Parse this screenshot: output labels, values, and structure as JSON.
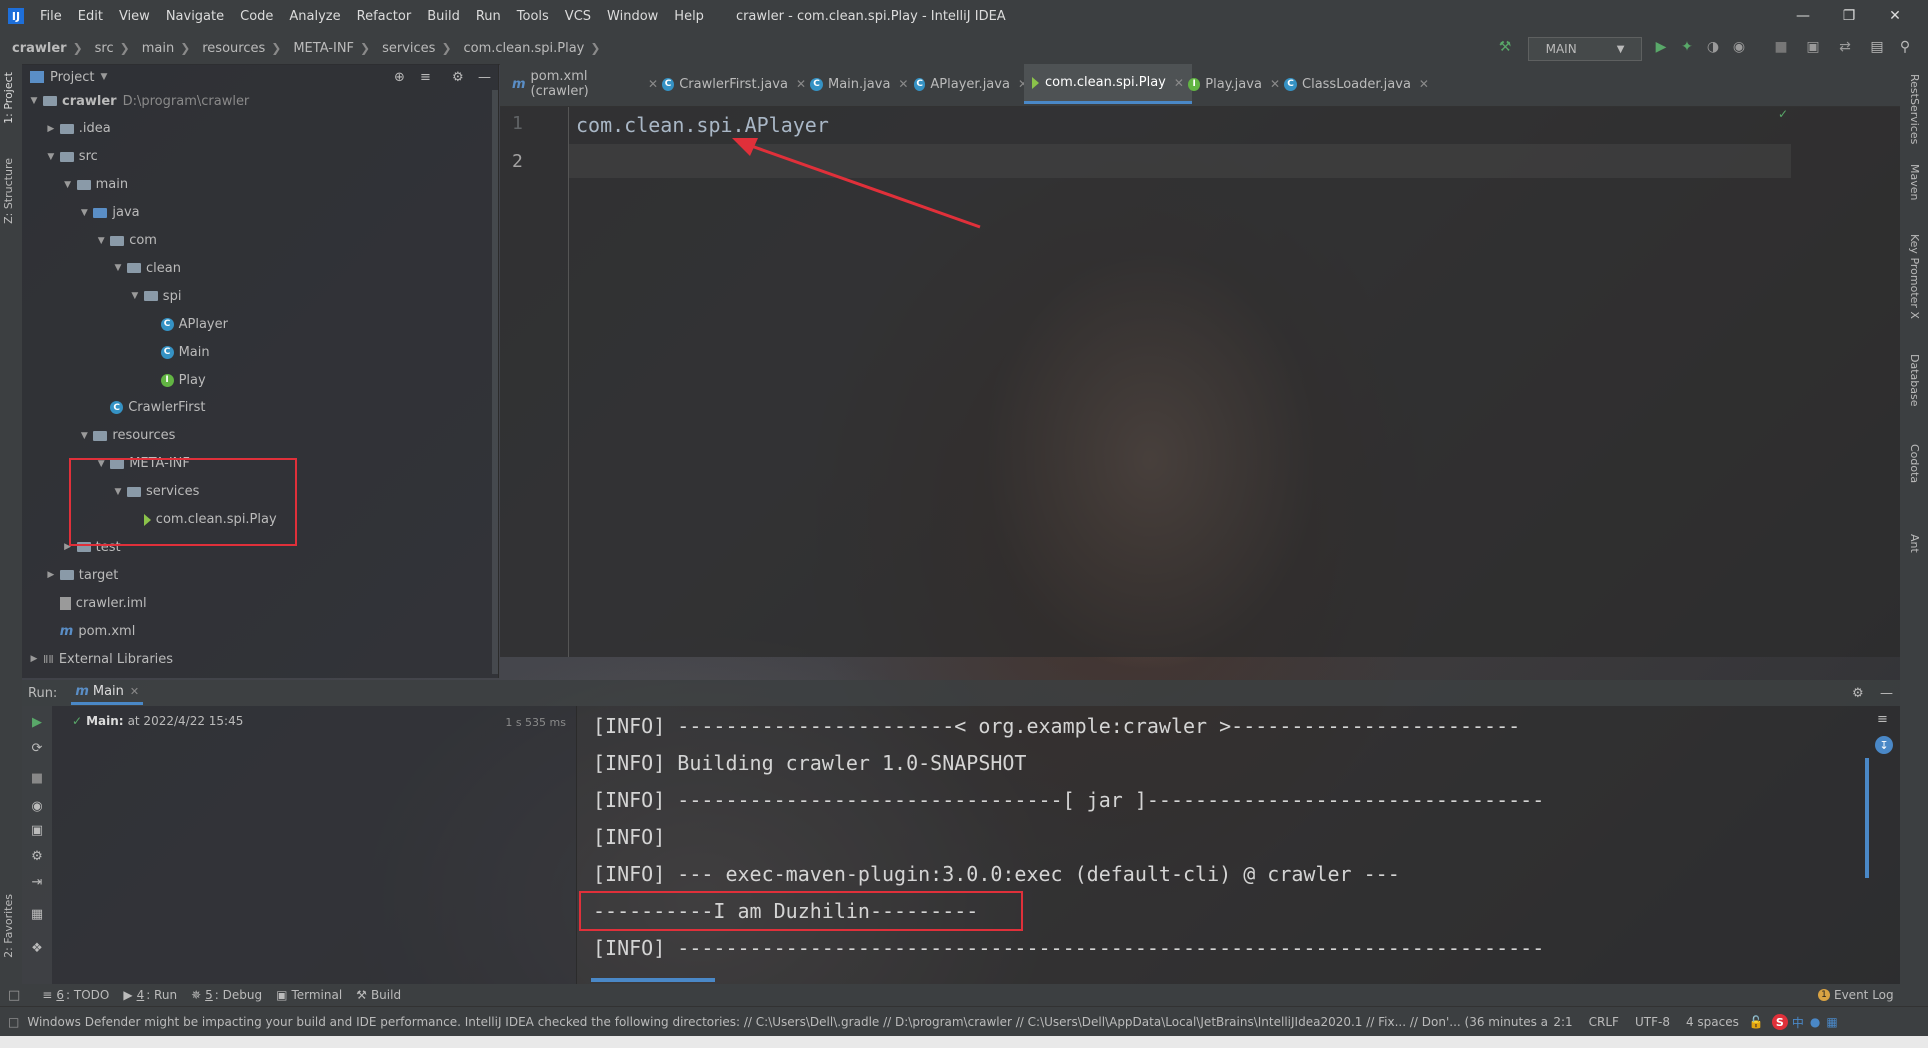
{
  "window": {
    "title": "crawler - com.clean.spi.Play - IntelliJ IDEA",
    "menu": [
      "File",
      "Edit",
      "View",
      "Navigate",
      "Code",
      "Analyze",
      "Refactor",
      "Build",
      "Run",
      "Tools",
      "VCS",
      "Window",
      "Help"
    ],
    "menu_mnemonics": [
      "F",
      "E",
      "V",
      "N",
      "C",
      "z",
      "R",
      "B",
      "u",
      "T",
      "S",
      "W",
      "H"
    ]
  },
  "breadcrumb": [
    "crawler",
    "src",
    "main",
    "resources",
    "META-INF",
    "services",
    "com.clean.spi.Play"
  ],
  "toolbar": {
    "run_config": "MAIN"
  },
  "left_strip": {
    "project_tab": "1: Project",
    "structure_tab": "Z: Structure",
    "favorites_tab": "2: Favorites"
  },
  "right_strip": [
    "RestServices",
    "Maven",
    "Key Promoter X",
    "Database",
    "Codota",
    "Ant"
  ],
  "project": {
    "header": "Project",
    "tree": [
      {
        "label": "crawler",
        "extra": "D:\\program\\crawler",
        "type": "root",
        "depth": 0,
        "open": true
      },
      {
        "label": ".idea",
        "type": "folder",
        "depth": 1,
        "open": false
      },
      {
        "label": "src",
        "type": "folder",
        "depth": 1,
        "open": true
      },
      {
        "label": "main",
        "type": "folder",
        "depth": 2,
        "open": true
      },
      {
        "label": "java",
        "type": "folder-blue",
        "depth": 3,
        "open": true
      },
      {
        "label": "com",
        "type": "folder",
        "depth": 4,
        "open": true
      },
      {
        "label": "clean",
        "type": "folder",
        "depth": 5,
        "open": true
      },
      {
        "label": "spi",
        "type": "folder",
        "depth": 6,
        "open": true
      },
      {
        "label": "APlayer",
        "type": "class",
        "depth": 7
      },
      {
        "label": "Main",
        "type": "class",
        "depth": 7
      },
      {
        "label": "Play",
        "type": "interface",
        "depth": 7
      },
      {
        "label": "CrawlerFirst",
        "type": "class",
        "depth": 4
      },
      {
        "label": "resources",
        "type": "folder-res",
        "depth": 3,
        "open": true
      },
      {
        "label": "META-INF",
        "type": "folder",
        "depth": 4,
        "open": true
      },
      {
        "label": "services",
        "type": "folder",
        "depth": 5,
        "open": true
      },
      {
        "label": "com.clean.spi.Play",
        "type": "file",
        "depth": 6
      },
      {
        "label": "test",
        "type": "folder",
        "depth": 2,
        "open": false
      },
      {
        "label": "target",
        "type": "folder-res",
        "depth": 1,
        "open": false
      },
      {
        "label": "crawler.iml",
        "type": "iml",
        "depth": 1
      },
      {
        "label": "pom.xml",
        "type": "maven",
        "depth": 1
      },
      {
        "label": "External Libraries",
        "type": "libs",
        "depth": 0,
        "open": false
      }
    ]
  },
  "tabs": [
    {
      "label": "pom.xml (crawler)",
      "icon": "maven",
      "active": false
    },
    {
      "label": "CrawlerFirst.java",
      "icon": "class",
      "active": false
    },
    {
      "label": "Main.java",
      "icon": "class",
      "active": false
    },
    {
      "label": "APlayer.java",
      "icon": "class",
      "active": false
    },
    {
      "label": "com.clean.spi.Play",
      "icon": "file",
      "active": true
    },
    {
      "label": "Play.java",
      "icon": "interface",
      "active": false
    },
    {
      "label": "ClassLoader.java",
      "icon": "class",
      "active": false
    }
  ],
  "editor": {
    "lines": [
      {
        "num": "1",
        "text": "com.clean.spi.APlayer"
      },
      {
        "num": "2",
        "text": ""
      }
    ]
  },
  "run": {
    "label": "Run:",
    "tab": "Main",
    "tree_item": "Main:",
    "tree_time": "at 2022/4/22 15:45",
    "duration": "1 s 535 ms",
    "console": [
      "[INFO] -----------------------< org.example:crawler >------------------------",
      "[INFO] Building crawler 1.0-SNAPSHOT",
      "[INFO] --------------------------------[ jar ]---------------------------------",
      "[INFO]",
      "[INFO] --- exec-maven-plugin:3.0.0:exec (default-cli) @ crawler ---",
      "----------I am Duzhilin---------",
      "[INFO] ------------------------------------------------------------------------"
    ]
  },
  "bottom_tools": [
    {
      "num": "6",
      "label": ": TODO"
    },
    {
      "num": "4",
      "label": ": Run"
    },
    {
      "num": "5",
      "label": ": Debug"
    },
    {
      "num": "",
      "label": "Terminal"
    },
    {
      "num": "",
      "label": "Build"
    }
  ],
  "event_log": "Event Log",
  "status": {
    "message": "Windows Defender might be impacting your build and IDE performance. IntelliJ IDEA checked the following directories: // C:\\Users\\Dell\\.gradle // D:\\program\\crawler // C:\\Users\\Dell\\AppData\\Local\\JetBrains\\IntelliJIdea2020.1 // Fix... // Don'... (36 minutes ago)",
    "position": "2:1",
    "line_sep": "CRLF",
    "encoding": "UTF-8",
    "indent": "4 spaces"
  },
  "tray": {
    "ime": "中"
  },
  "colors": {
    "accent": "#4a88c7",
    "highlight_box": "#e0303a",
    "run_green": "#59a869"
  }
}
